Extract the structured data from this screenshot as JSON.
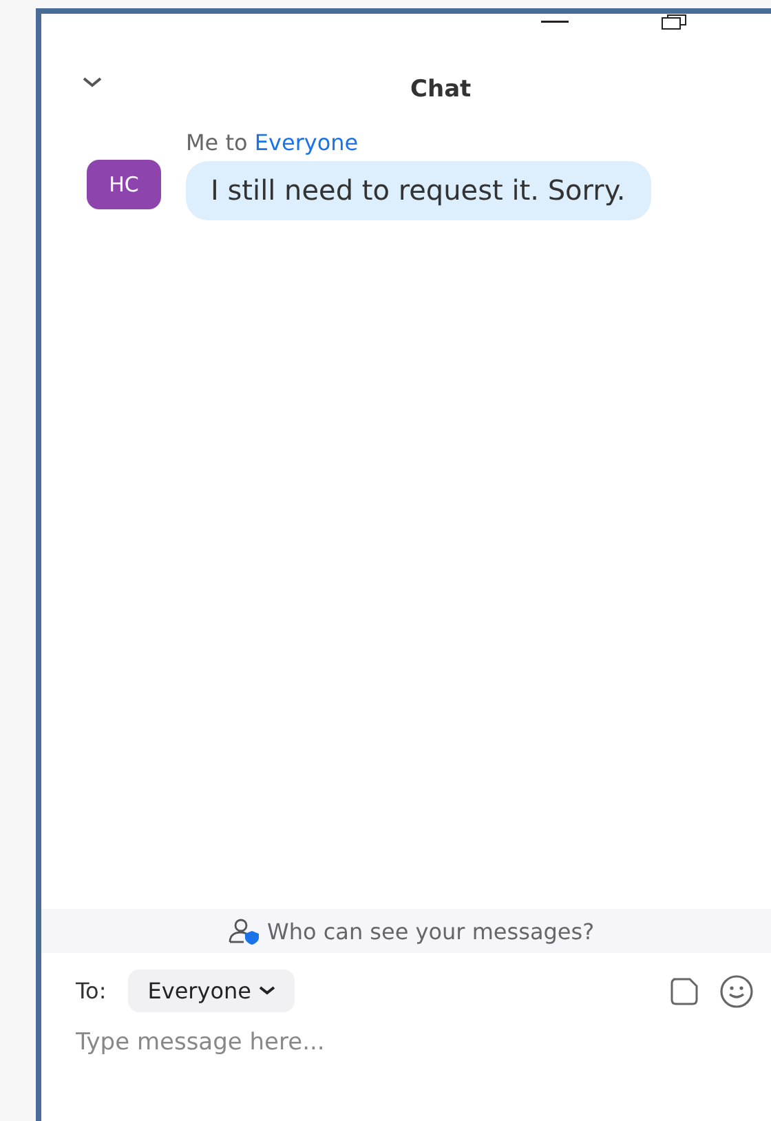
{
  "window": {
    "title": "Chat"
  },
  "messages": [
    {
      "avatar": "HC",
      "sender": "Me",
      "to_word": "to",
      "recipient": "Everyone",
      "text": "I still need to request it. Sorry."
    }
  ],
  "privacy_notice": "Who can see your messages?",
  "composer": {
    "to_label": "To:",
    "recipient": "Everyone",
    "placeholder": "Type message here..."
  }
}
